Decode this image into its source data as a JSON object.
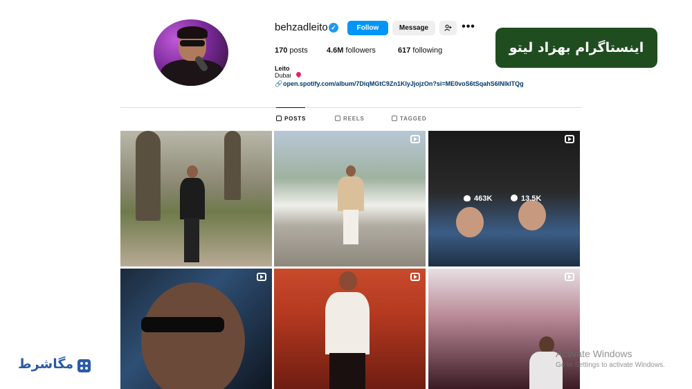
{
  "profile": {
    "username": "behzadleito",
    "verified_badge": "✓",
    "follow_label": "Follow",
    "message_label": "Message",
    "add_user_icon": "add-user-icon",
    "more_label": "•••",
    "stats": {
      "posts_value": "170",
      "posts_label": "posts",
      "followers_value": "4.6M",
      "followers_label": "followers",
      "following_value": "617",
      "following_label": "following"
    },
    "full_name": "Leito",
    "location": "Dubai",
    "link": "open.spotify.com/album/7DiqMGtC9Zn1KlyJjojzOn?si=ME0voS6tSqahS6INlkITQg"
  },
  "banner": {
    "text": "اینستاگرام بهزاد لیتو",
    "background": "#1f4d1f"
  },
  "tabs": [
    {
      "label": "POSTS",
      "active": true
    },
    {
      "label": "REELS",
      "active": false
    },
    {
      "label": "TAGGED",
      "active": false
    }
  ],
  "grid": {
    "hover_stats": {
      "likes": "463K",
      "comments": "13.5K"
    }
  },
  "watermark": {
    "title": "Activate Windows",
    "subtitle": "Go to Settings to activate Windows."
  },
  "logo": {
    "text": "مگاشرط",
    "color": "#2a5aa8"
  },
  "colors": {
    "accent": "#0095f6",
    "link": "#00376b",
    "verified": "#1d9bf0"
  }
}
